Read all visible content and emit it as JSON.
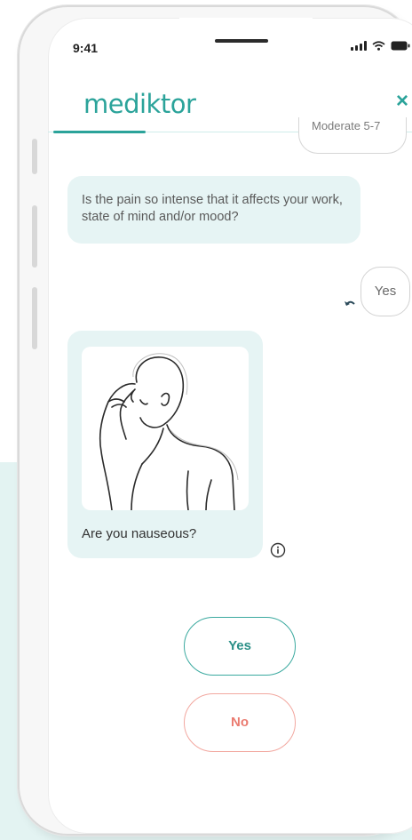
{
  "status_bar": {
    "time": "9:41",
    "icons": [
      "signal-icon",
      "wifi-icon",
      "battery-icon"
    ]
  },
  "header": {
    "logo": "mediktor",
    "close_label": "×"
  },
  "conversation": {
    "previous_answer": "Moderate 5-7",
    "bot_question": "Is the pain so intense that it affects your work, state of mind and/or mood?",
    "user_answer": "Yes",
    "image_question": "Are you nauseous?"
  },
  "answers": {
    "yes_label": "Yes",
    "no_label": "No"
  },
  "colors": {
    "brand": "#2ba39a",
    "bubble": "#e6f4f4",
    "no_accent": "#ea7b70"
  }
}
